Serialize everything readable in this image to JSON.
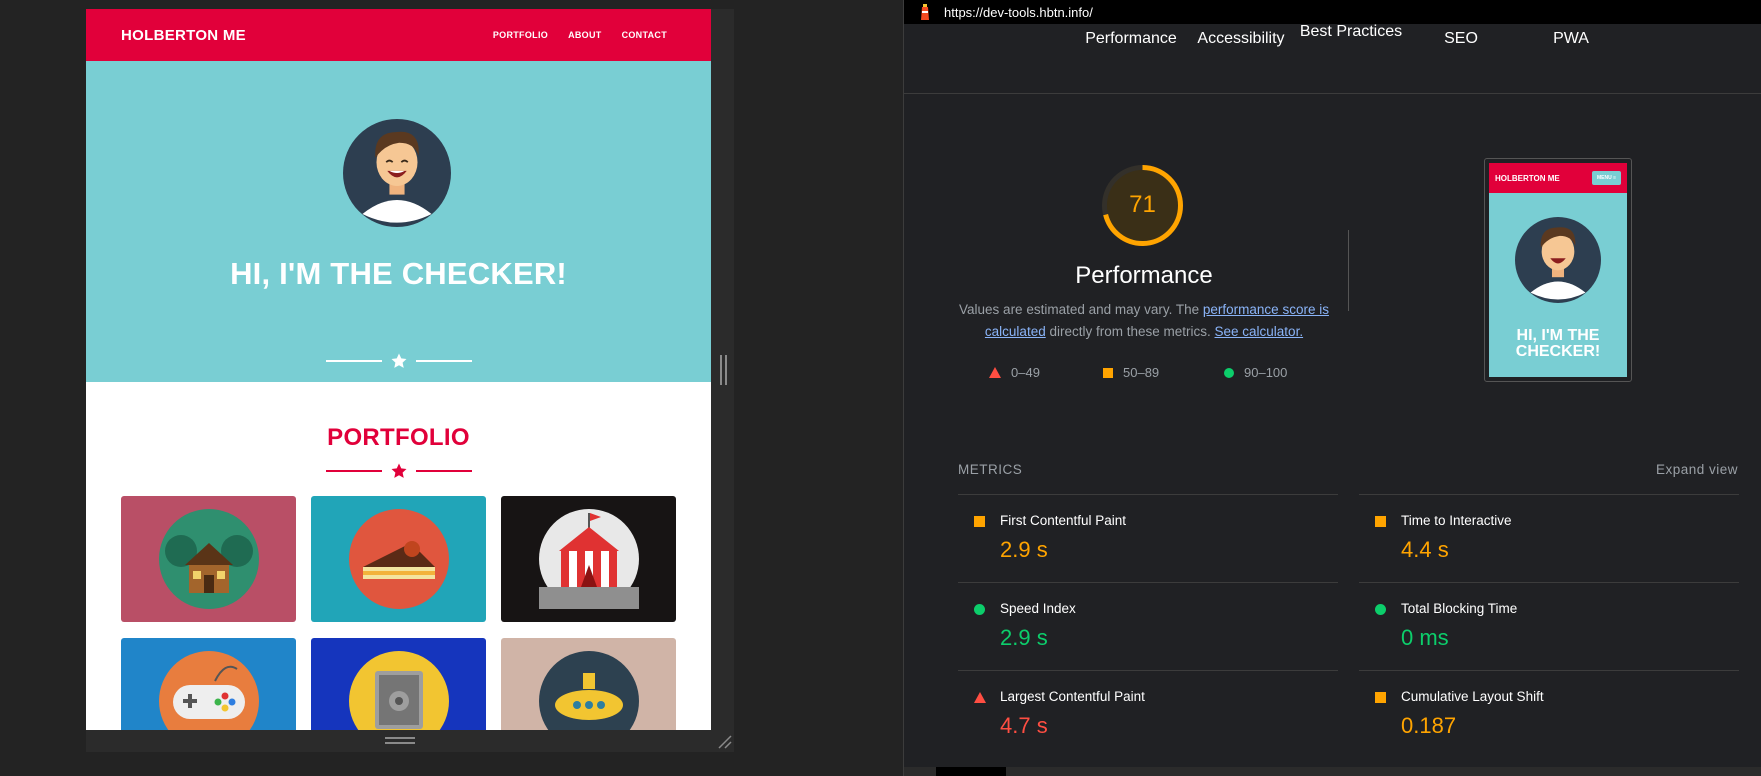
{
  "site": {
    "logo": "HOLBERTON ME",
    "nav": [
      "PORTFOLIO",
      "ABOUT",
      "CONTACT"
    ],
    "hero_title": "HI, I'M THE CHECKER!",
    "portfolio_title": "PORTFOLIO",
    "tiles": [
      {
        "name": "cabin",
        "bg": "#b94f66"
      },
      {
        "name": "cake",
        "bg": "#21a5b8"
      },
      {
        "name": "circus",
        "bg": "#171414"
      },
      {
        "name": "game-controller",
        "bg": "#2085c9"
      },
      {
        "name": "safe",
        "bg": "#1535bd"
      },
      {
        "name": "submarine",
        "bg": "#d0b4a7"
      }
    ]
  },
  "lighthouse": {
    "url": "https://dev-tools.hbtn.info/",
    "tabs": [
      "Performance",
      "Accessibility",
      "Best Practices",
      "SEO",
      "PWA"
    ],
    "score": "71",
    "score_value": 71,
    "score_color": "#ffa400",
    "title": "Performance",
    "desc_prefix": "Values are estimated and may vary. The ",
    "desc_link1": "performance score is calculated",
    "desc_mid": " directly from these metrics. ",
    "desc_link2": "See calculator.",
    "legend": [
      "0–49",
      "50–89",
      "90–100"
    ],
    "thumb": {
      "logo": "HOLBERTON ME",
      "menu": "MENU ≡",
      "title": "HI, I'M THE CHECKER!"
    },
    "metrics_label": "METRICS",
    "expand_label": "Expand view",
    "metrics": [
      {
        "name": "First Contentful Paint",
        "value": "2.9 s",
        "status": "average",
        "color": "#ffa400"
      },
      {
        "name": "Time to Interactive",
        "value": "4.4 s",
        "status": "average",
        "color": "#ffa400"
      },
      {
        "name": "Speed Index",
        "value": "2.9 s",
        "status": "pass",
        "color": "#0cce6b"
      },
      {
        "name": "Total Blocking Time",
        "value": "0 ms",
        "status": "pass",
        "color": "#0cce6b"
      },
      {
        "name": "Largest Contentful Paint",
        "value": "4.7 s",
        "status": "fail",
        "color": "#ff4e42"
      },
      {
        "name": "Cumulative Layout Shift",
        "value": "0.187",
        "status": "average",
        "color": "#ffa400"
      }
    ]
  }
}
